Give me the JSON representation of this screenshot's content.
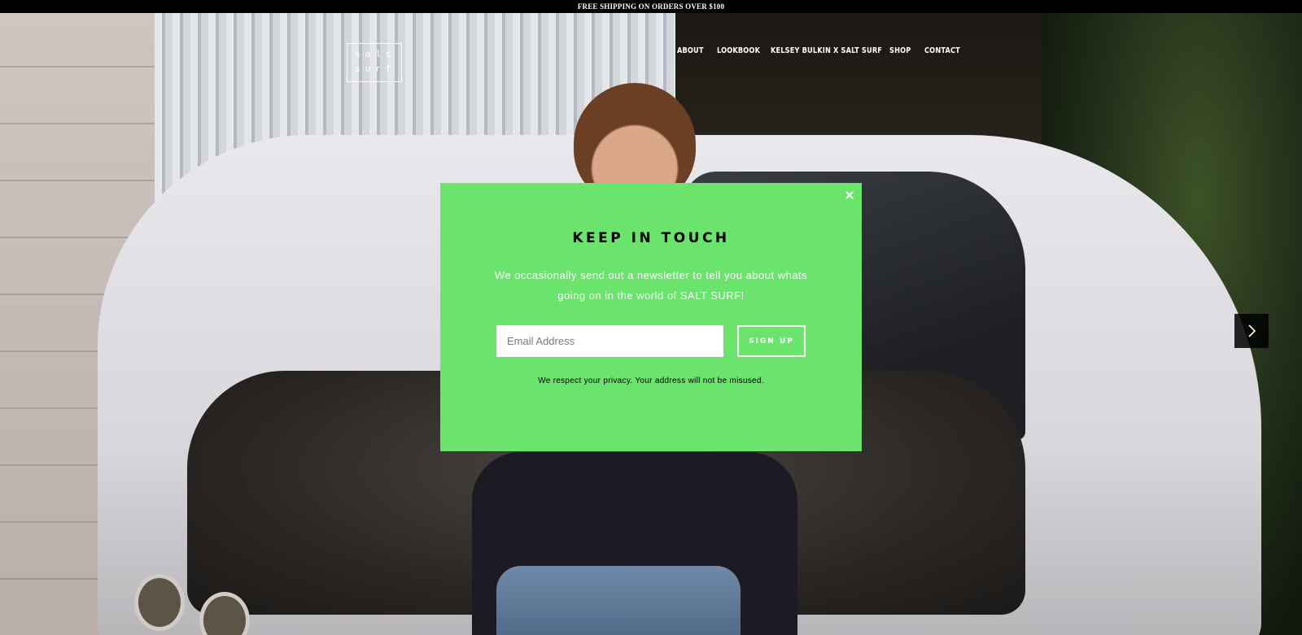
{
  "announcement": {
    "text": "FREE SHIPPING ON ORDERS OVER $100"
  },
  "header": {
    "logo": {
      "line1": "salt",
      "line2": "surf"
    },
    "nav": [
      {
        "label": "ABOUT"
      },
      {
        "label": "LOOKBOOK"
      },
      {
        "label": "KELSEY BULKIN X SALT SURF"
      },
      {
        "label": "SHOP"
      },
      {
        "label": "CONTACT"
      }
    ]
  },
  "slider": {
    "next_icon": "chevron-right-icon"
  },
  "modal": {
    "close_icon": "close-icon",
    "close_glyph": "×",
    "title": "KEEP IN TOUCH",
    "description": "We occasionally send out a newsletter to tell you about whats going on in the world of SALT SURF!",
    "email_placeholder": "Email Address",
    "signup_label": "SIGN UP",
    "privacy_note": "We respect your privacy. Your address will not be misused.",
    "background_color": "#6ae46d"
  }
}
